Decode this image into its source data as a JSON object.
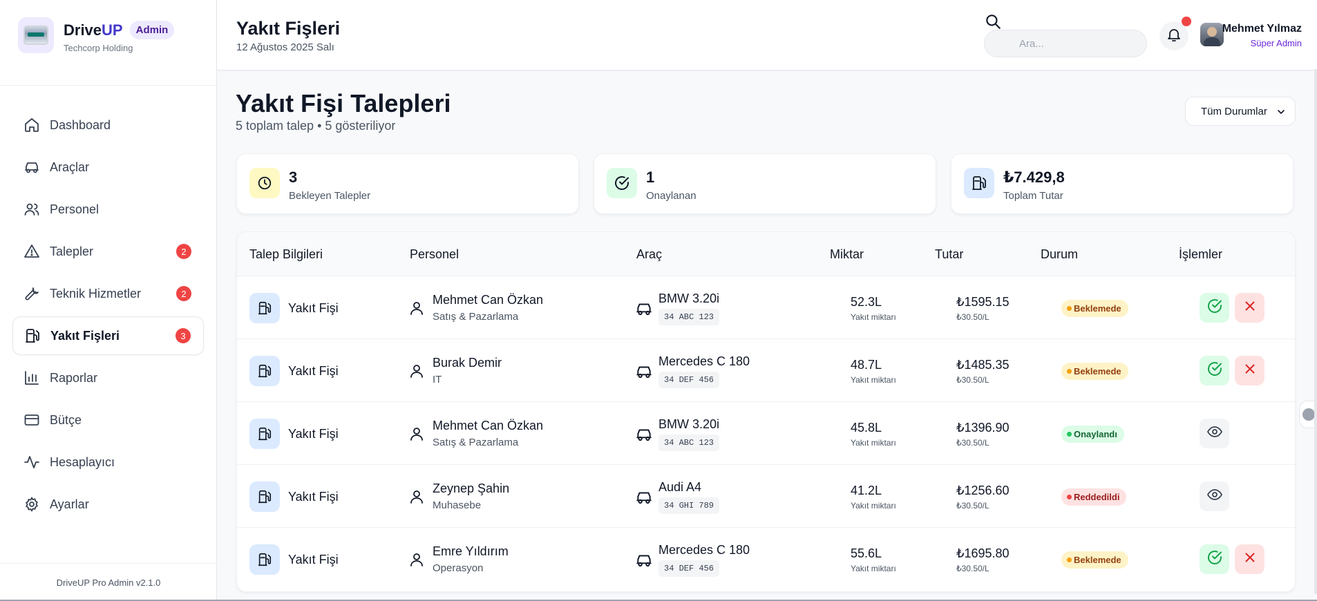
{
  "brand": {
    "name_prefix": "Drive",
    "name_suffix": "UP",
    "badge": "Admin",
    "company": "Techcorp Holding"
  },
  "sidebar": {
    "items": [
      {
        "label": "Dashboard",
        "icon": "home-icon",
        "badge": ""
      },
      {
        "label": "Araçlar",
        "icon": "car-icon",
        "badge": ""
      },
      {
        "label": "Personel",
        "icon": "users-icon",
        "badge": ""
      },
      {
        "label": "Talepler",
        "icon": "alert-triangle-icon",
        "badge": "2"
      },
      {
        "label": "Teknik Hizmetler",
        "icon": "wrench-icon",
        "badge": "2"
      },
      {
        "label": "Yakıt Fişleri",
        "icon": "fuel-icon",
        "badge": "3",
        "active": true
      },
      {
        "label": "Raporlar",
        "icon": "bar-chart-icon",
        "badge": ""
      },
      {
        "label": "Bütçe",
        "icon": "credit-card-icon",
        "badge": ""
      },
      {
        "label": "Hesaplayıcı",
        "icon": "activity-icon",
        "badge": ""
      },
      {
        "label": "Ayarlar",
        "icon": "gear-icon",
        "badge": ""
      }
    ],
    "footer": "DriveUP Pro Admin v2.1.0"
  },
  "header": {
    "title": "Yakıt Fişleri",
    "date": "12 Ağustos 2025 Salı",
    "search_placeholder": "Ara...",
    "user_name": "Mehmet Yılmaz",
    "user_role": "Süper Admin"
  },
  "main": {
    "title": "Yakıt Fişi Talepleri",
    "subtitle": "5 toplam talep • 5 gösteriliyor",
    "filter_value": "Tüm Durumlar",
    "stats": [
      {
        "value": "3",
        "label": "Bekleyen Talepler",
        "icon": "clock-icon",
        "color": "#fef9c3"
      },
      {
        "value": "1",
        "label": "Onaylanan",
        "icon": "check-circle-icon",
        "color": "#dcfce7"
      },
      {
        "value": "₺7.429,8",
        "label": "Toplam Tutar",
        "icon": "fuel-icon",
        "color": "#dbeafe"
      }
    ]
  },
  "table": {
    "headers": [
      "Talep Bilgileri",
      "Personel",
      "Araç",
      "Miktar",
      "Tutar",
      "Durum",
      "İşlemler"
    ],
    "rows": [
      {
        "type": "Yakıt Fişi",
        "person": "Mehmet Can Özkan",
        "dept": "Satış & Pazarlama",
        "car": "BMW 3.20i",
        "plate": "34 ABC 123",
        "amount": "52.3L",
        "amount_label": "Yakıt miktarı",
        "price": "₺1595.15",
        "unit_price": "₺30.50/L",
        "status": "Beklemede",
        "status_kind": "pending"
      },
      {
        "type": "Yakıt Fişi",
        "person": "Burak Demir",
        "dept": "IT",
        "car": "Mercedes C 180",
        "plate": "34 DEF 456",
        "amount": "48.7L",
        "amount_label": "Yakıt miktarı",
        "price": "₺1485.35",
        "unit_price": "₺30.50/L",
        "status": "Beklemede",
        "status_kind": "pending"
      },
      {
        "type": "Yakıt Fişi",
        "person": "Mehmet Can Özkan",
        "dept": "Satış & Pazarlama",
        "car": "BMW 3.20i",
        "plate": "34 ABC 123",
        "amount": "45.8L",
        "amount_label": "Yakıt miktarı",
        "price": "₺1396.90",
        "unit_price": "₺30.50/L",
        "status": "Onaylandı",
        "status_kind": "approved"
      },
      {
        "type": "Yakıt Fişi",
        "person": "Zeynep Şahin",
        "dept": "Muhasebe",
        "car": "Audi A4",
        "plate": "34 GHI 789",
        "amount": "41.2L",
        "amount_label": "Yakıt miktarı",
        "price": "₺1256.60",
        "unit_price": "₺30.50/L",
        "status": "Reddedildi",
        "status_kind": "rejected"
      },
      {
        "type": "Yakıt Fişi",
        "person": "Emre Yıldırım",
        "dept": "Operasyon",
        "car": "Mercedes C 180",
        "plate": "34 DEF 456",
        "amount": "55.6L",
        "amount_label": "Yakıt miktarı",
        "price": "₺1695.80",
        "unit_price": "₺30.50/L",
        "status": "Beklemede",
        "status_kind": "pending"
      }
    ]
  },
  "colors": {
    "accent": "#4338ca",
    "danger": "#ef4444",
    "success": "#16a34a"
  }
}
